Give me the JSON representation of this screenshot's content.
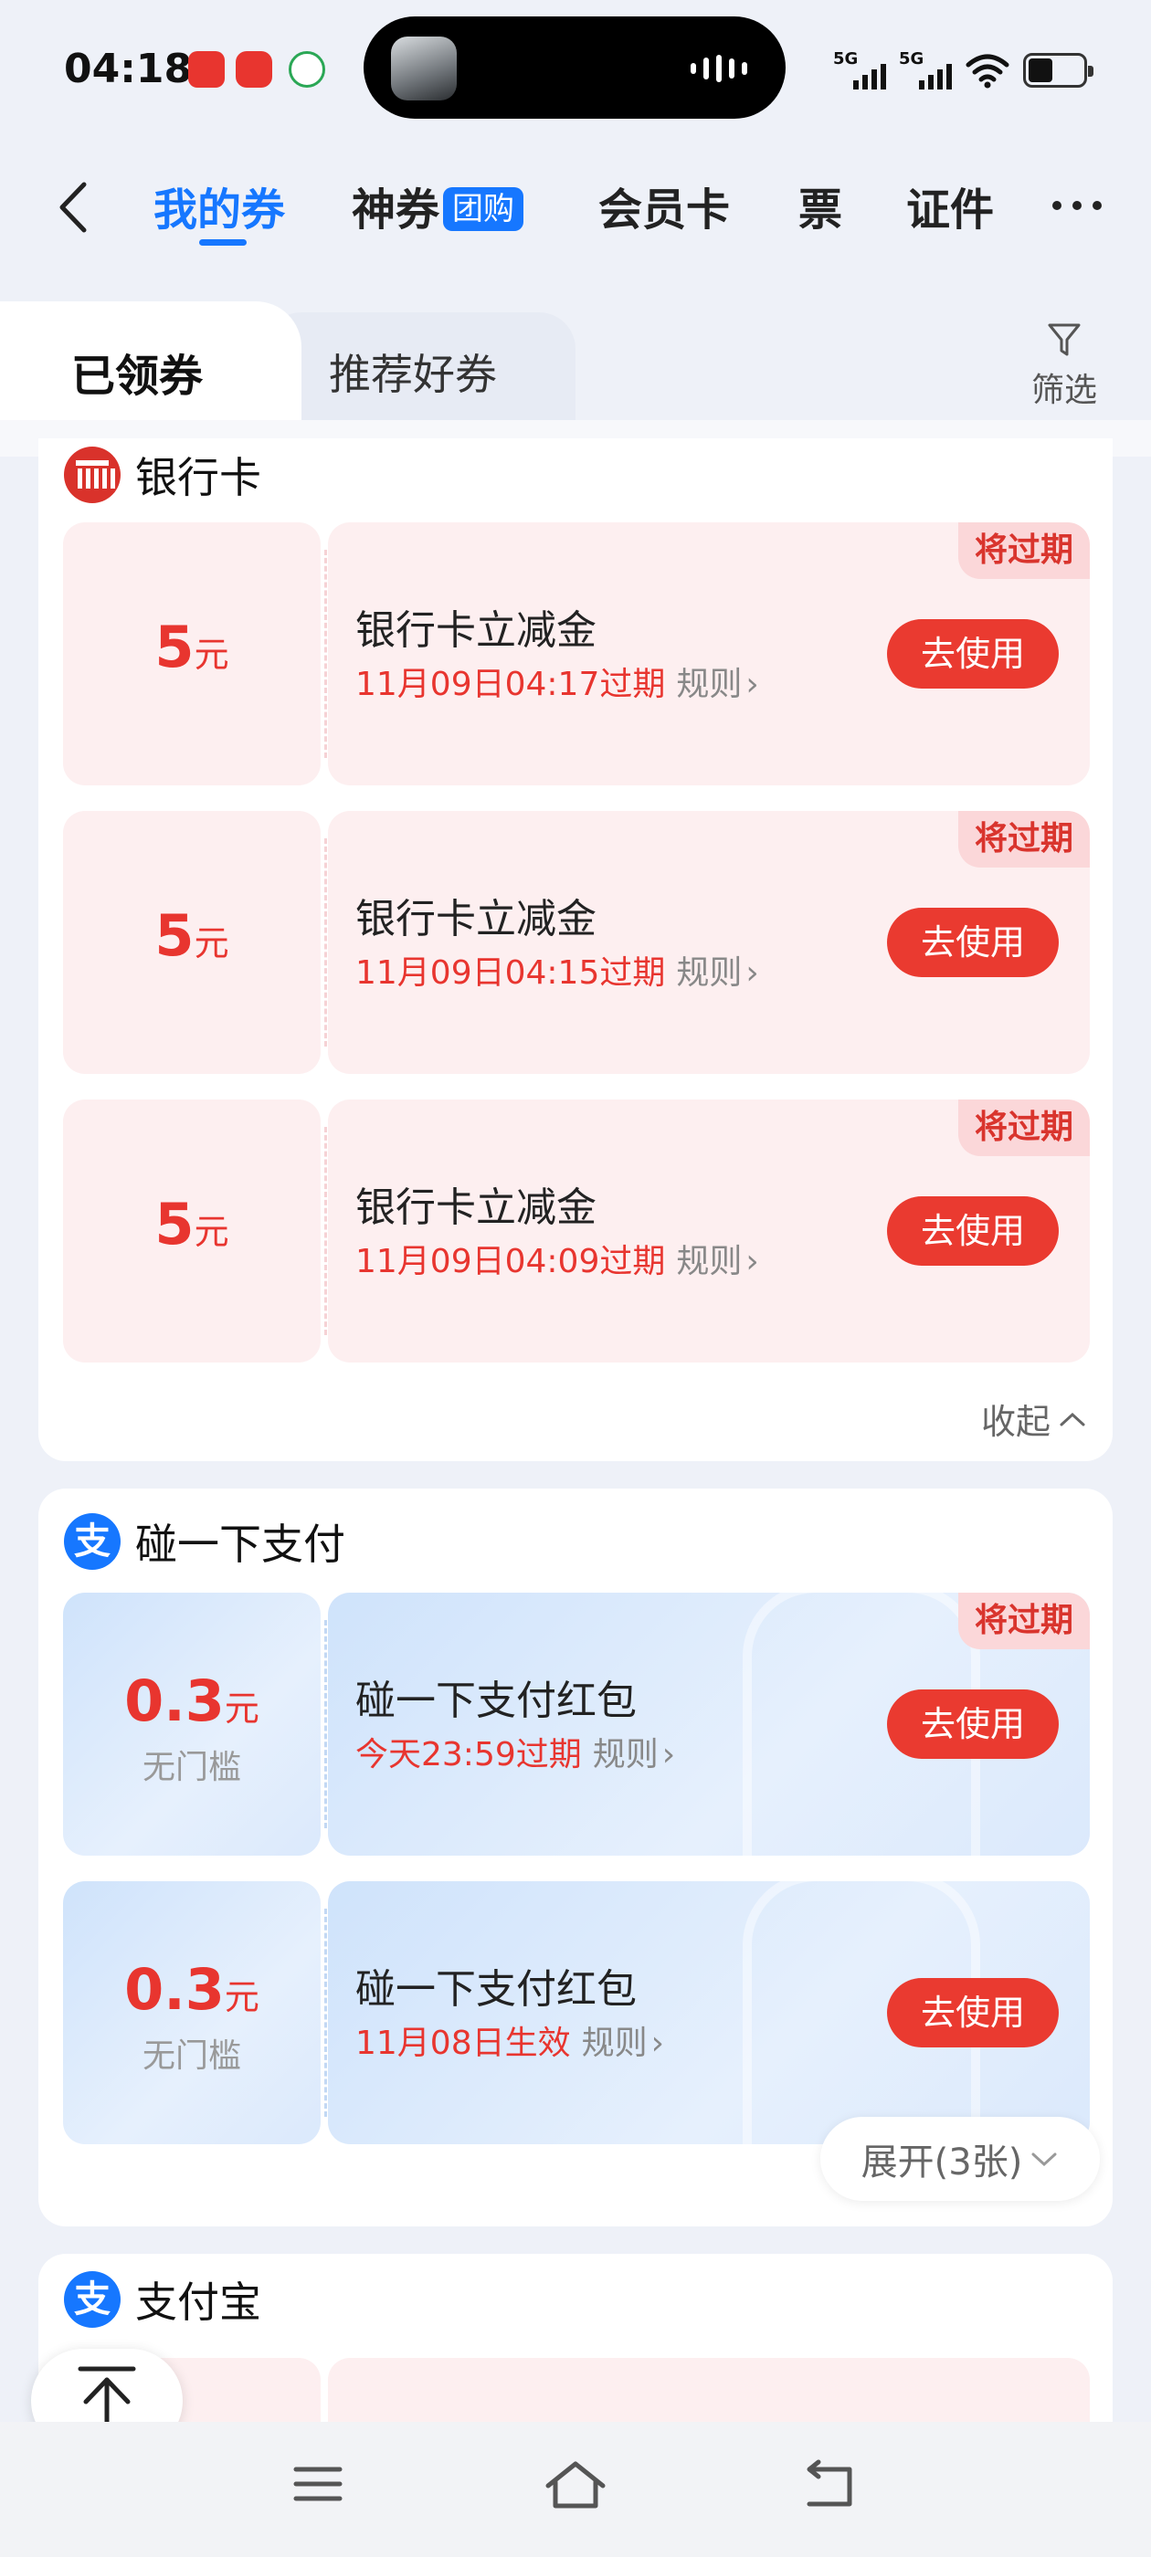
{
  "status_bar": {
    "time": "04:18",
    "signal_1_label": "5G",
    "signal_2_label": "5G"
  },
  "nav": {
    "tabs": [
      {
        "label": "我的券"
      },
      {
        "label": "神券",
        "badge": "团购"
      },
      {
        "label": "会员卡"
      },
      {
        "label": "票"
      },
      {
        "label": "证件"
      }
    ],
    "active_color": "#1677ff"
  },
  "subtabs": {
    "active": "已领券",
    "other": "推荐好券",
    "filter_label": "筛选"
  },
  "sections": [
    {
      "title": "银行卡",
      "icon": "bank-card-icon",
      "coupons": [
        {
          "amount": "5",
          "unit": "元",
          "name": "银行卡立减金",
          "expire": "11月09日04:17过期",
          "rule": "规则",
          "button": "去使用",
          "tag": "将过期"
        },
        {
          "amount": "5",
          "unit": "元",
          "name": "银行卡立减金",
          "expire": "11月09日04:15过期",
          "rule": "规则",
          "button": "去使用",
          "tag": "将过期"
        },
        {
          "amount": "5",
          "unit": "元",
          "name": "银行卡立减金",
          "expire": "11月09日04:09过期",
          "rule": "规则",
          "button": "去使用",
          "tag": "将过期"
        }
      ],
      "collapse_label": "收起"
    },
    {
      "title": "碰一下支付",
      "icon": "alipay-icon",
      "coupons": [
        {
          "amount": "0.3",
          "unit": "元",
          "threshold": "无门槛",
          "name": "碰一下支付红包",
          "expire": "今天23:59过期",
          "rule": "规则",
          "button": "去使用",
          "tag": "将过期"
        },
        {
          "amount": "0.3",
          "unit": "元",
          "threshold": "无门槛",
          "name": "碰一下支付红包",
          "expire": "11月08日生效",
          "rule": "规则",
          "button": "去使用"
        }
      ],
      "expand_label": "展开(3张)"
    },
    {
      "title": "支付宝",
      "icon": "alipay-icon"
    }
  ],
  "colors": {
    "accent_red": "#ea3a30",
    "brand_blue": "#1677ff",
    "coupon_pink": "#fdeff0"
  }
}
